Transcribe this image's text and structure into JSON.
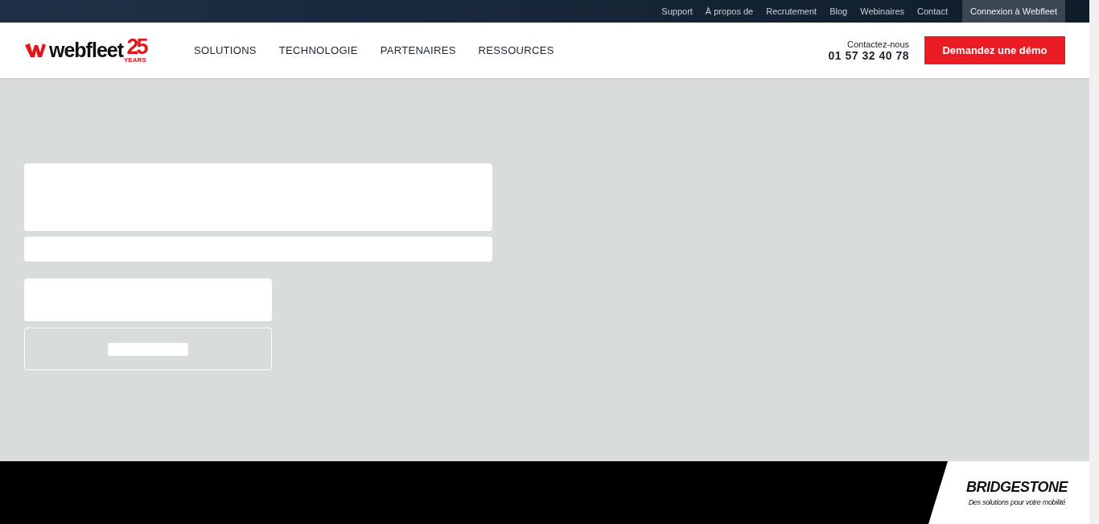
{
  "top_bar": {
    "links": [
      {
        "label": "Support"
      },
      {
        "label": "À propos de"
      },
      {
        "label": "Recrutement"
      },
      {
        "label": "Blog"
      },
      {
        "label": "Webinaires"
      },
      {
        "label": "Contact"
      }
    ],
    "login": {
      "label": "Connexion à Webfleet"
    }
  },
  "header": {
    "logo": {
      "wordmark": "webfleet",
      "anniversary": "25",
      "years": "YEARS"
    },
    "nav": [
      {
        "label": "SOLUTIONS"
      },
      {
        "label": "TECHNOLOGIE"
      },
      {
        "label": "PARTENAIRES"
      },
      {
        "label": "RESSOURCES"
      }
    ],
    "contact": {
      "label": "Contactez-nous",
      "phone": "01 57 32 40 78"
    },
    "cta": {
      "label": "Demandez une démo"
    }
  },
  "footer": {
    "brand": {
      "name": "BRIDGESTONE",
      "tagline": "Des solutions pour votre mobilité"
    }
  }
}
